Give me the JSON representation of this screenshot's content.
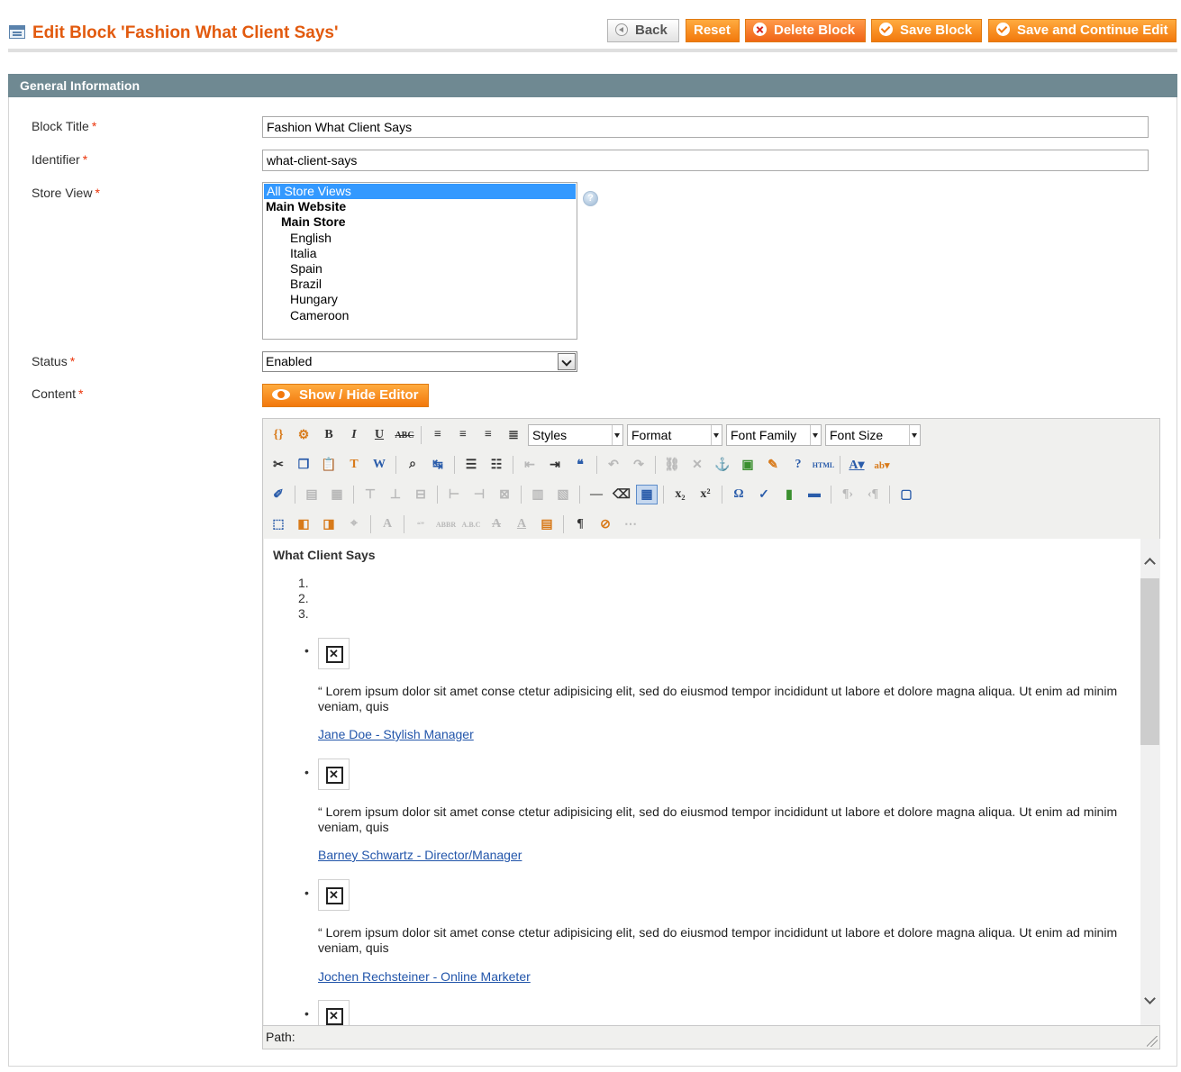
{
  "header": {
    "title": "Edit Block 'Fashion What Client Says'",
    "buttons": {
      "back": "Back",
      "reset": "Reset",
      "delete": "Delete Block",
      "save": "Save Block",
      "save_continue": "Save and Continue Edit"
    }
  },
  "section": {
    "title": "General Information"
  },
  "form": {
    "block_title": {
      "label": "Block Title",
      "value": "Fashion What Client Says"
    },
    "identifier": {
      "label": "Identifier",
      "value": "what-client-says"
    },
    "store_view": {
      "label": "Store View",
      "options": [
        "All Store Views",
        "Main Website",
        "Main Store",
        "English",
        "Italia",
        "Spain",
        "Brazil",
        "Hungary",
        "Cameroon"
      ]
    },
    "status": {
      "label": "Status",
      "value": "Enabled"
    },
    "content": {
      "label": "Content",
      "toggle_editor": "Show / Hide Editor"
    },
    "required_mark": "*"
  },
  "editor": {
    "selects": {
      "styles": "Styles",
      "format": "Format",
      "font_family": "Font Family",
      "font_size": "Font Size"
    },
    "content": {
      "heading": "What Client Says",
      "numbers": [
        "1.",
        "2.",
        "3."
      ],
      "bullet": "•",
      "testimonials": [
        {
          "text": "“ Lorem ipsum dolor sit amet conse ctetur adipisicing elit, sed do eiusmod tempor incididunt ut labore et dolore magna aliqua. Ut enim ad minim veniam, quis",
          "author": "Jane Doe - Stylish Manager"
        },
        {
          "text": "“ Lorem ipsum dolor sit amet conse ctetur adipisicing elit, sed do eiusmod tempor incididunt ut labore et dolore magna aliqua. Ut enim ad minim veniam, quis",
          "author": "Barney Schwartz - Director/Manager"
        },
        {
          "text": "“ Lorem ipsum dolor sit amet conse ctetur adipisicing elit, sed do eiusmod tempor incididunt ut labore et dolore magna aliqua. Ut enim ad minim veniam, quis",
          "author": "Jochen Rechsteiner - Online Marketer"
        }
      ]
    },
    "path_label": "Path:"
  },
  "colors": {
    "accent": "#e25a0e",
    "button": "#f2780c",
    "section_header": "#6f8992",
    "link": "#2255aa",
    "selected_option": "#3399ff"
  }
}
